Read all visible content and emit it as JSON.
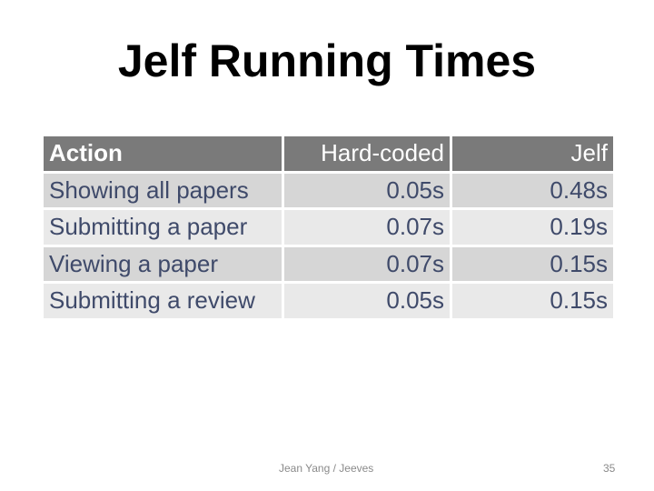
{
  "slide": {
    "title": "Jelf Running Times",
    "table": {
      "headers": [
        "Action",
        "Hard-coded",
        "Jelf"
      ],
      "rows": [
        [
          "Showing all papers",
          "0.05s",
          "0.48s"
        ],
        [
          "Submitting a paper",
          "0.07s",
          "0.19s"
        ],
        [
          "Viewing a paper",
          "0.07s",
          "0.15s"
        ],
        [
          "Submitting a review",
          "0.05s",
          "0.15s"
        ]
      ]
    },
    "footer": {
      "author": "Jean Yang / Jeeves",
      "page_number": "35"
    }
  }
}
